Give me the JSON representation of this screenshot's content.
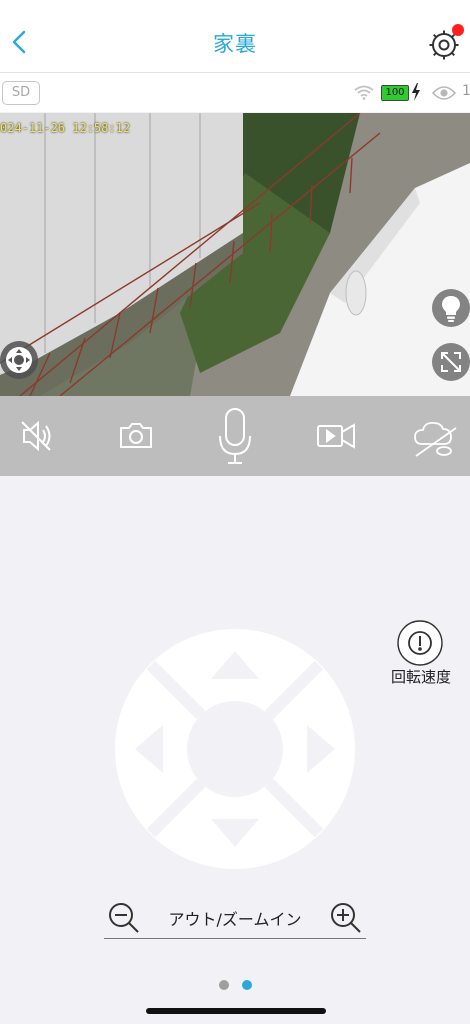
{
  "header": {
    "title": "家裏",
    "back_icon": "chevron-left-icon",
    "settings_icon": "gear-icon",
    "accent": "#2aa8d8",
    "notification_color": "#ff1f1f"
  },
  "status": {
    "storage_badge": "SD",
    "battery_level": "100",
    "viewer_count": "1"
  },
  "video": {
    "timestamp": "024-11-26  12:58:12"
  },
  "toolbar": {
    "icons": [
      "mute-icon",
      "snapshot-icon",
      "microphone-icon",
      "record-icon",
      "cloud-icon"
    ]
  },
  "controls": {
    "rotation_speed_label": "回転速度",
    "zoom_label": "アウト/ズームイン"
  },
  "pager": {
    "count": 2,
    "active_index": 1,
    "active_color": "#2aa8d8",
    "inactive_color": "#9e9e9e"
  }
}
